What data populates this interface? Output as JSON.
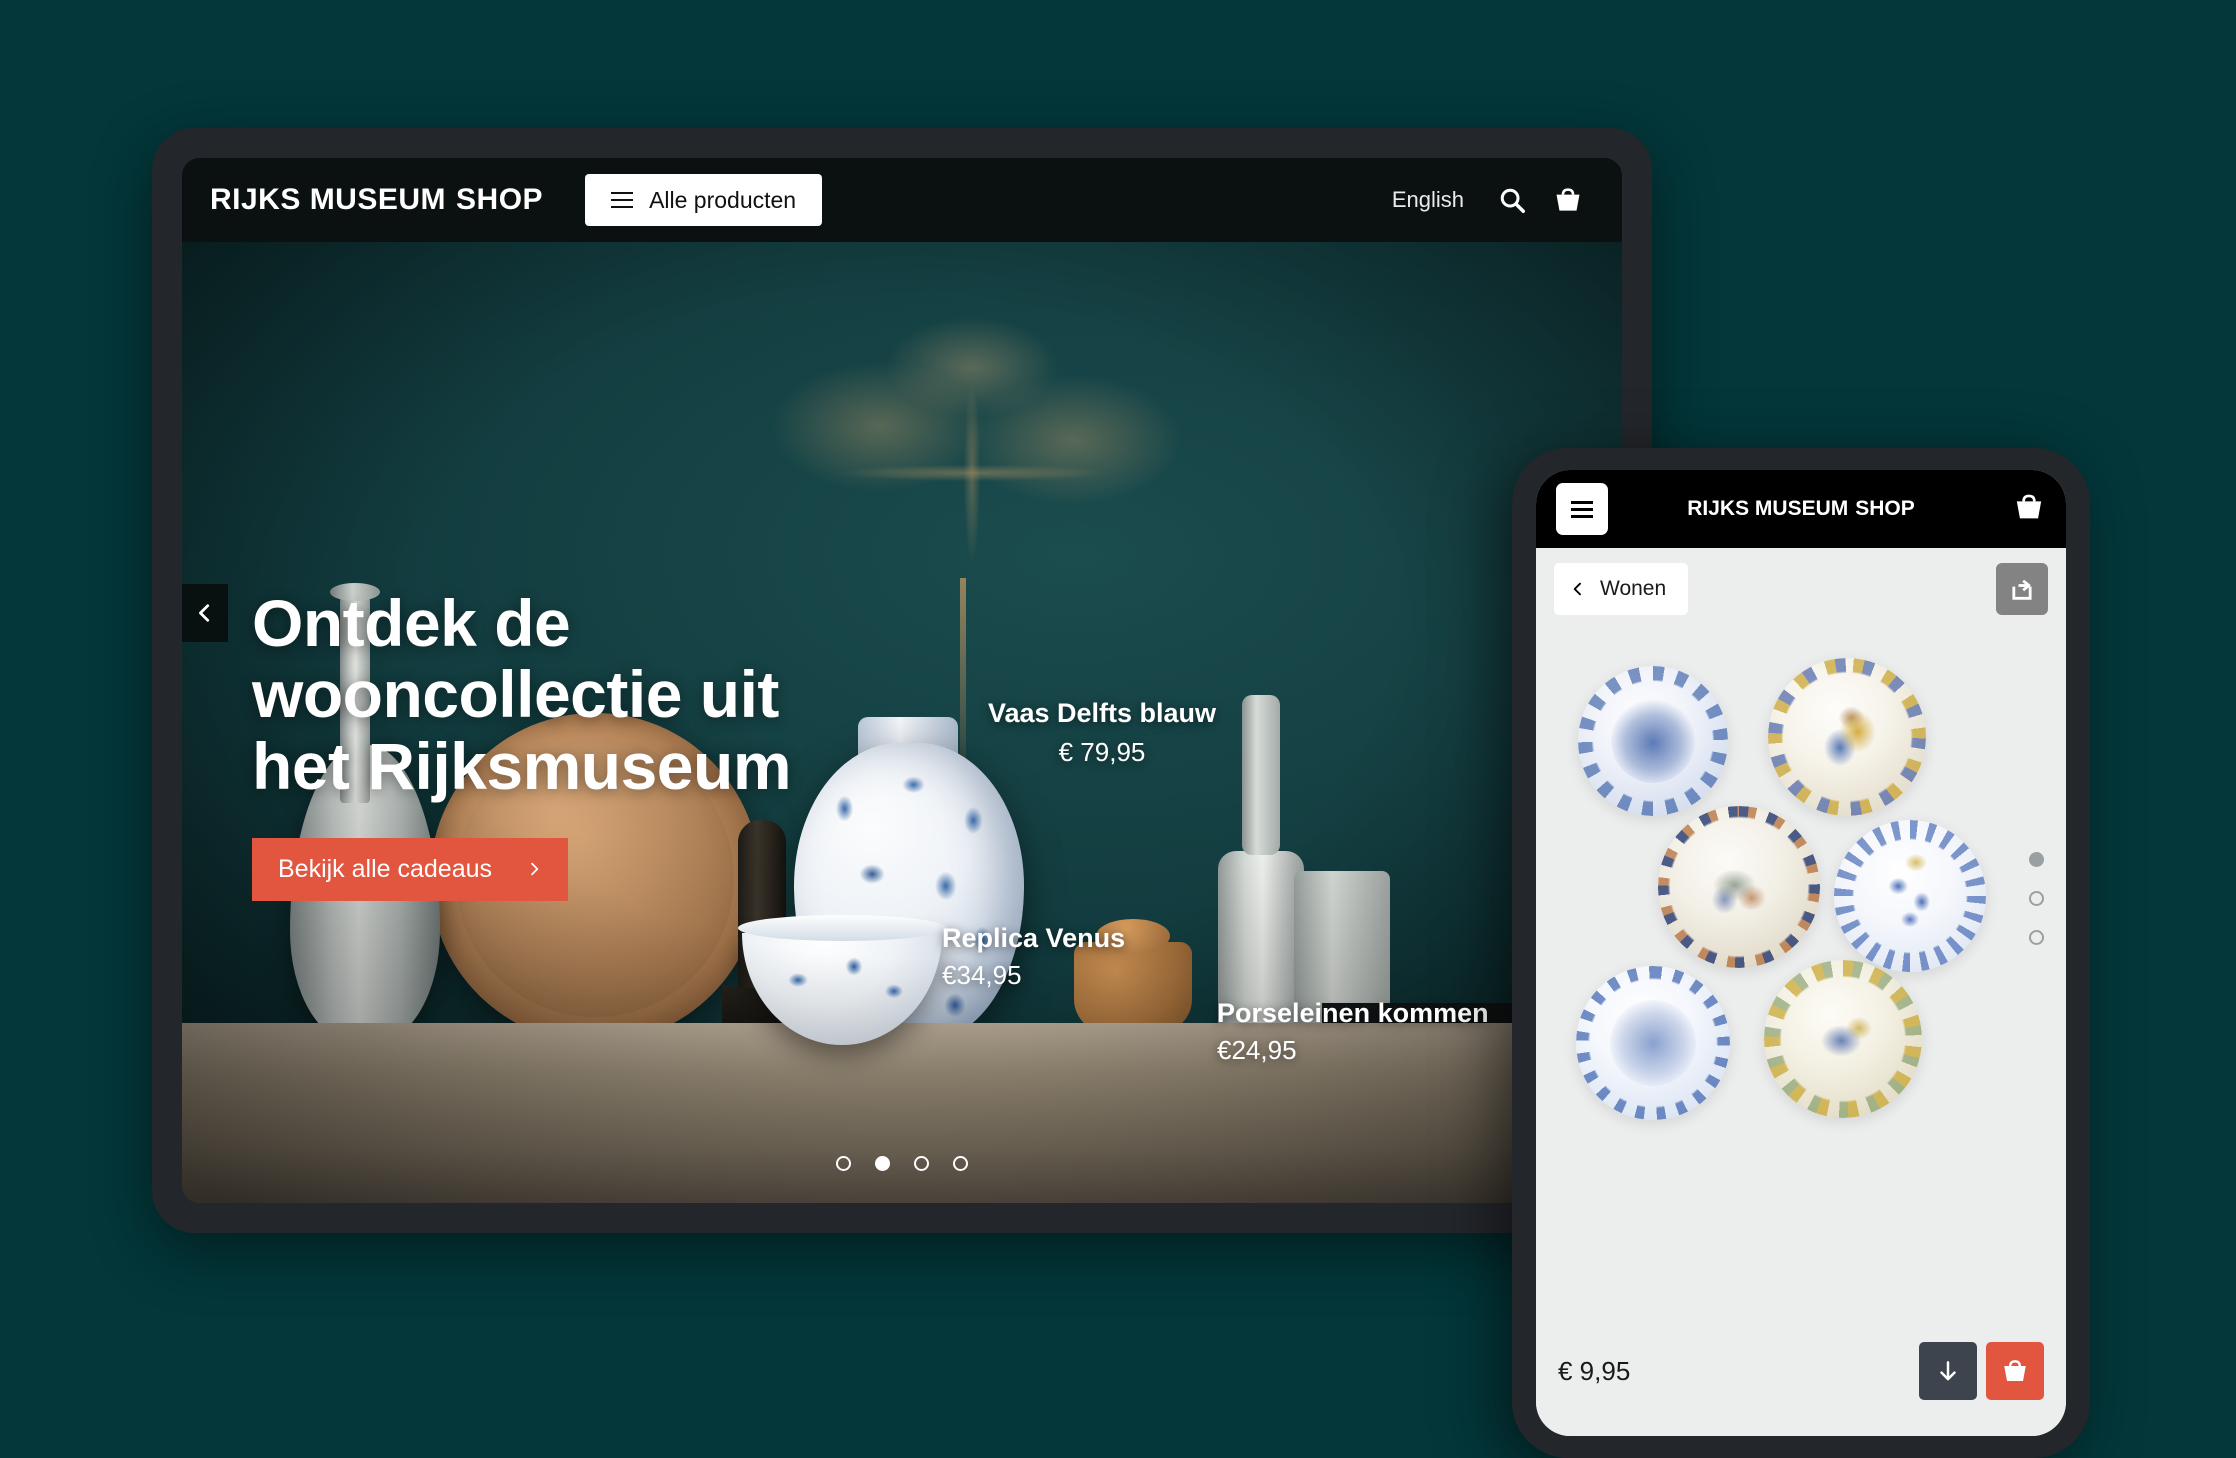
{
  "theme": {
    "background": "#03373a",
    "accent": "#e2553f",
    "bezel": "#23262a",
    "topbar": "#0b1011",
    "phone_surface": "#eceded",
    "dark_button": "#3d444d",
    "share_button": "#838383"
  },
  "tablet": {
    "header": {
      "logo_rijks": "RIJKS MUSEUM",
      "logo_shop": "SHOP",
      "all_products_label": "Alle producten",
      "menu_icon": "hamburger-icon",
      "language_label": "English",
      "search_icon": "search-icon",
      "cart_icon": "basket-icon"
    },
    "carousel": {
      "prev_icon": "chevron-left-icon",
      "dots": [
        {
          "active": false
        },
        {
          "active": true
        },
        {
          "active": false
        },
        {
          "active": false
        }
      ],
      "active_index": 2,
      "total": 4
    },
    "hero": {
      "title": "Ontdek de wooncollectie uit het Rijksmuseum",
      "cta_label": "Bekijk alle cadeaus",
      "cta_icon": "chevron-right-icon"
    },
    "products": [
      {
        "name": "Vaas Delfts blauw",
        "price": "€ 79,95"
      },
      {
        "name": "Replica Venus",
        "price": "€34,95"
      },
      {
        "name": "Porseleinen kommen",
        "price": "€24,95"
      }
    ]
  },
  "phone": {
    "header": {
      "menu_icon": "hamburger-icon",
      "logo_rijks": "RIJKS MUSEUM",
      "logo_shop": "SHOP",
      "cart_icon": "basket-icon"
    },
    "subbar": {
      "back_icon": "chevron-left-icon",
      "back_label": "Wonen",
      "share_icon": "share-icon"
    },
    "gallery": {
      "item_count": 6,
      "dots": [
        {
          "active": true
        },
        {
          "active": false
        },
        {
          "active": false
        }
      ],
      "active_index": 1,
      "total": 3
    },
    "footer": {
      "price": "€ 9,95",
      "download_icon": "arrow-down-icon",
      "add_to_cart_icon": "basket-icon"
    }
  }
}
